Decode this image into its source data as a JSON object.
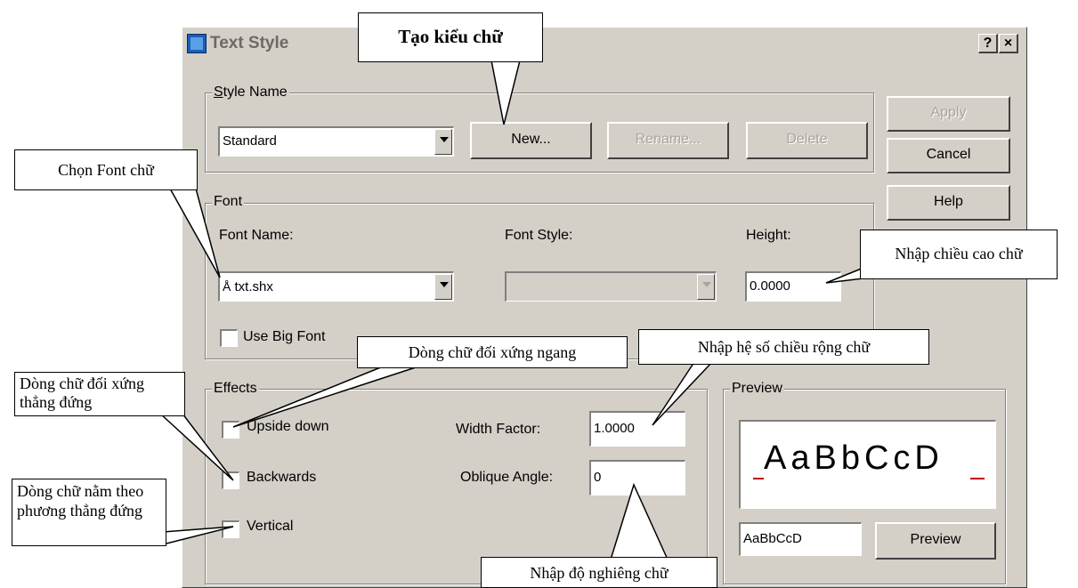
{
  "window": {
    "title": "Text Style",
    "help_button": "?",
    "close_button": "×"
  },
  "style_name": {
    "group_label": "Style Name",
    "selected_style": "Standard",
    "new_button": "New...",
    "rename_button": "Rename...",
    "delete_button": "Delete"
  },
  "side_buttons": {
    "apply": "Apply",
    "cancel": "Cancel",
    "help": "Help"
  },
  "font": {
    "group_label": "Font",
    "font_name_label": "Font Name:",
    "font_name_value": "txt.shx",
    "font_style_label": "Font Style:",
    "font_style_value": "",
    "height_label": "Height:",
    "height_value": "0.0000",
    "use_big_font_label": "Use Big Font"
  },
  "effects": {
    "group_label": "Effects",
    "upside_down_label": "Upside down",
    "backwards_label": "Backwards",
    "vertical_label": "Vertical",
    "width_factor_label": "Width Factor:",
    "width_factor_value": "1.0000",
    "oblique_angle_label": "Oblique Angle:",
    "oblique_angle_value": "0"
  },
  "preview": {
    "group_label": "Preview",
    "sample_text": "AaBbCcD",
    "preview_input_value": "AaBbCcD",
    "preview_button": "Preview"
  },
  "callouts": {
    "create_style": "Tạo kiểu chữ",
    "choose_font": "Chọn Font chữ",
    "enter_height": "Nhập chiều cao chữ",
    "mirror_horizontal": "Dòng chữ đối xứng ngang",
    "enter_width_factor": "Nhập hệ số chiều rộng chữ",
    "mirror_vertical": "Dòng chữ đối xứng thẳng đứng",
    "vertical_text": "Dòng chữ nằm theo phương thẳng đứng",
    "enter_oblique": "Nhập độ nghiêng chữ"
  },
  "colors": {
    "dialog_bg": "#d4d0c8",
    "preview_baseline": "#c00000"
  }
}
